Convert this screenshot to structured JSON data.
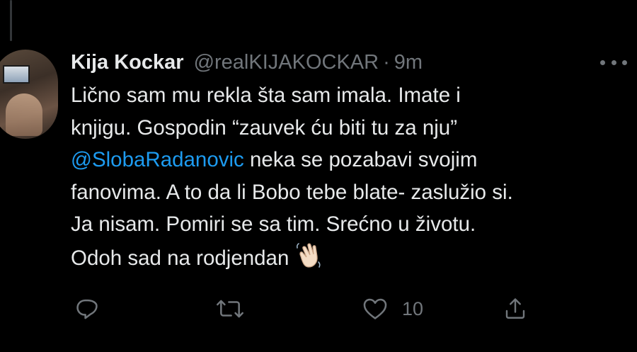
{
  "tweet": {
    "display_name": "Kija Kockar",
    "handle": "@realKIJAKOCKAR",
    "separator": "·",
    "time": "9m",
    "text_lines": [
      "Lično sam mu rekla šta sam imala. Imate i",
      "knjigu. Gospodin “zauvek ću biti tu za nju”",
      "neka se pozabavi svojim",
      "fanovima. A to da li Bobo tebe blate- zaslužio si.",
      "Ja nisam. Pomiri se sa tim. Srećno u životu.",
      "Odoh sad na rodjendan"
    ],
    "mention": "@SlobaRadanovic",
    "emoji": "waving-hand-emoji"
  },
  "actions": {
    "reply_icon": "reply-icon",
    "retweet_icon": "retweet-icon",
    "like_icon": "heart-icon",
    "like_count": "10",
    "share_icon": "share-icon"
  },
  "colors": {
    "background": "#000000",
    "text": "#e7e9ea",
    "secondary": "#71767b",
    "link": "#1d9bf0"
  }
}
